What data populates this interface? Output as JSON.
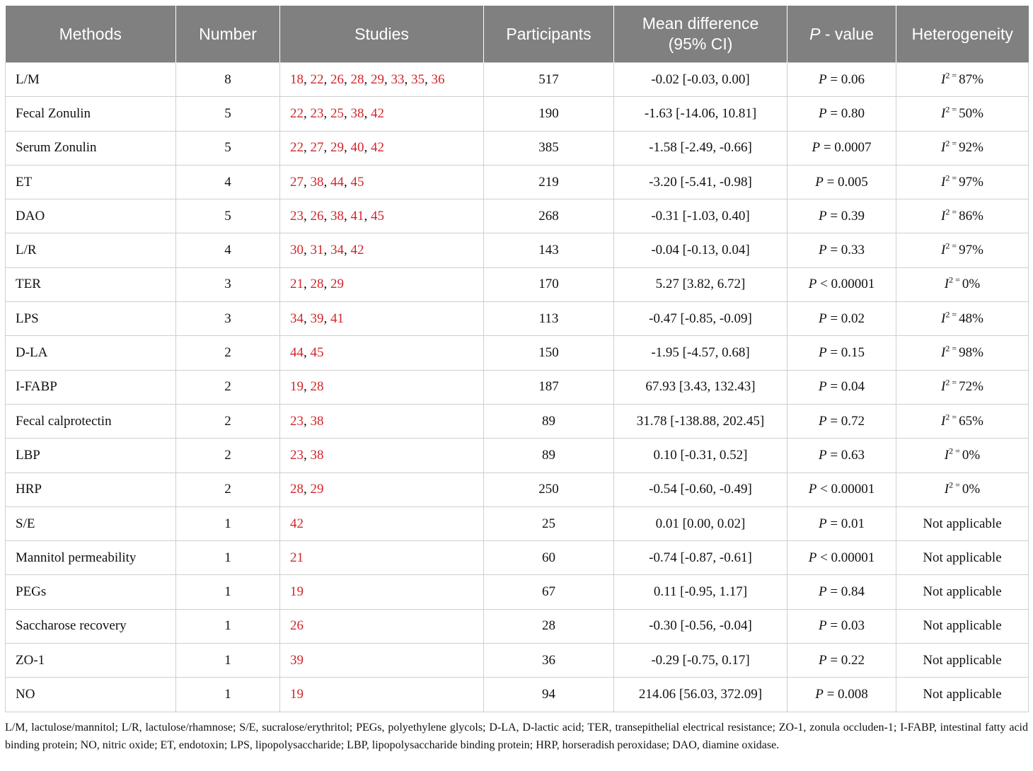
{
  "table": {
    "headers": {
      "methods": "Methods",
      "number": "Number",
      "studies": "Studies",
      "participants": "Participants",
      "mean_difference_line1": "Mean difference",
      "mean_difference_line2": "(95% CI)",
      "p_value_italic": "P",
      "p_value_rest": " - value",
      "heterogeneity": "Heterogeneity"
    },
    "rows": [
      {
        "method": "L/M",
        "number": "8",
        "studies": [
          "18",
          "22",
          "26",
          "28",
          "29",
          "33",
          "35",
          "36"
        ],
        "participants": "517",
        "mean_difference": "-0.02 [-0.03, 0.00]",
        "p_op": " = ",
        "p_val": "0.06",
        "heterogeneity": "87%"
      },
      {
        "method": "Fecal Zonulin",
        "number": "5",
        "studies": [
          "22",
          "23",
          "25",
          "38",
          "42"
        ],
        "participants": "190",
        "mean_difference": "-1.63 [-14.06, 10.81]",
        "p_op": " = ",
        "p_val": "0.80",
        "heterogeneity": "50%"
      },
      {
        "method": "Serum Zonulin",
        "number": "5",
        "studies": [
          "22",
          "27",
          "29",
          "40",
          "42"
        ],
        "participants": "385",
        "mean_difference": "-1.58 [-2.49, -0.66]",
        "p_op": " = ",
        "p_val": "0.0007",
        "heterogeneity": "92%"
      },
      {
        "method": "ET",
        "number": "4",
        "studies": [
          "27",
          "38",
          "44",
          "45"
        ],
        "participants": "219",
        "mean_difference": "-3.20 [-5.41, -0.98]",
        "p_op": " = ",
        "p_val": "0.005",
        "heterogeneity": "97%"
      },
      {
        "method": "DAO",
        "number": "5",
        "studies": [
          "23",
          "26",
          "38",
          "41",
          "45"
        ],
        "participants": "268",
        "mean_difference": "-0.31 [-1.03, 0.40]",
        "p_op": " = ",
        "p_val": "0.39",
        "heterogeneity": "86%"
      },
      {
        "method": "L/R",
        "number": "4",
        "studies": [
          "30",
          "31",
          "34",
          "42"
        ],
        "participants": "143",
        "mean_difference": "-0.04 [-0.13, 0.04]",
        "p_op": " = ",
        "p_val": "0.33",
        "heterogeneity": "97%"
      },
      {
        "method": "TER",
        "number": "3",
        "studies": [
          "21",
          "28",
          "29"
        ],
        "participants": "170",
        "mean_difference": "5.27 [3.82, 6.72]",
        "p_op": " < ",
        "p_val": "0.00001",
        "heterogeneity": "0%"
      },
      {
        "method": "LPS",
        "number": "3",
        "studies": [
          "34",
          "39",
          "41"
        ],
        "participants": "113",
        "mean_difference": "-0.47 [-0.85, -0.09]",
        "p_op": " = ",
        "p_val": "0.02",
        "heterogeneity": "48%"
      },
      {
        "method": "D-LA",
        "number": "2",
        "studies": [
          "44",
          "45"
        ],
        "participants": "150",
        "mean_difference": "-1.95 [-4.57, 0.68]",
        "p_op": " = ",
        "p_val": "0.15",
        "heterogeneity": "98%"
      },
      {
        "method": "I-FABP",
        "number": "2",
        "studies": [
          "19",
          "28"
        ],
        "participants": "187",
        "mean_difference": "67.93 [3.43, 132.43]",
        "p_op": " = ",
        "p_val": "0.04",
        "heterogeneity": "72%"
      },
      {
        "method": "Fecal calprotectin",
        "number": "2",
        "studies": [
          "23",
          "38"
        ],
        "participants": "89",
        "mean_difference": "31.78 [-138.88, 202.45]",
        "p_op": " = ",
        "p_val": "0.72",
        "heterogeneity": "65%"
      },
      {
        "method": "LBP",
        "number": "2",
        "studies": [
          "23",
          "38"
        ],
        "participants": "89",
        "mean_difference": "0.10 [-0.31, 0.52]",
        "p_op": " = ",
        "p_val": "0.63",
        "heterogeneity": "0%"
      },
      {
        "method": "HRP",
        "number": "2",
        "studies": [
          "28",
          "29"
        ],
        "participants": "250",
        "mean_difference": "-0.54 [-0.60, -0.49]",
        "p_op": " < ",
        "p_val": "0.00001",
        "heterogeneity": "0%"
      },
      {
        "method": "S/E",
        "number": "1",
        "studies": [
          "42"
        ],
        "participants": "25",
        "mean_difference": "0.01 [0.00, 0.02]",
        "p_op": " = ",
        "p_val": "0.01",
        "heterogeneity": "Not applicable"
      },
      {
        "method": "Mannitol permeability",
        "number": "1",
        "studies": [
          "21"
        ],
        "participants": "60",
        "mean_difference": "-0.74 [-0.87, -0.61]",
        "p_op": " < ",
        "p_val": "0.00001",
        "heterogeneity": "Not applicable"
      },
      {
        "method": "PEGs",
        "number": "1",
        "studies": [
          "19"
        ],
        "participants": "67",
        "mean_difference": "0.11 [-0.95, 1.17]",
        "p_op": " = ",
        "p_val": "0.84",
        "heterogeneity": "Not applicable"
      },
      {
        "method": "Saccharose recovery",
        "number": "1",
        "studies": [
          "26"
        ],
        "participants": "28",
        "mean_difference": "-0.30 [-0.56, -0.04]",
        "p_op": " = ",
        "p_val": "0.03",
        "heterogeneity": "Not applicable"
      },
      {
        "method": "ZO-1",
        "number": "1",
        "studies": [
          "39"
        ],
        "participants": "36",
        "mean_difference": "-0.29 [-0.75, 0.17]",
        "p_op": " = ",
        "p_val": "0.22",
        "heterogeneity": "Not applicable"
      },
      {
        "method": "NO",
        "number": "1",
        "studies": [
          "19"
        ],
        "participants": "94",
        "mean_difference": "214.06 [56.03, 372.09]",
        "p_op": " = ",
        "p_val": "0.008",
        "heterogeneity": "Not applicable"
      }
    ]
  },
  "labels": {
    "p_symbol": "P",
    "i_symbol": "I",
    "i_superscript": "2",
    "i_equals": " = ",
    "study_separator": ", "
  },
  "footnote": "L/M, lactulose/mannitol; L/R, lactulose/rhamnose; S/E, sucralose/erythritol; PEGs, polyethylene glycols; D-LA, D-lactic acid; TER, transepithelial electrical resistance; ZO-1, zonula occluden-1; I-FABP, intestinal fatty acid binding protein; NO, nitric oxide; ET, endotoxin; LPS, lipopolysaccharide; LBP, lipopolysaccharide binding protein; HRP, horseradish peroxidase; DAO, diamine oxidase.",
  "colors": {
    "header_bg": "#808080",
    "header_text": "#ffffff",
    "reference_link": "#d0262b",
    "grid_line": "#cfcfcf"
  }
}
